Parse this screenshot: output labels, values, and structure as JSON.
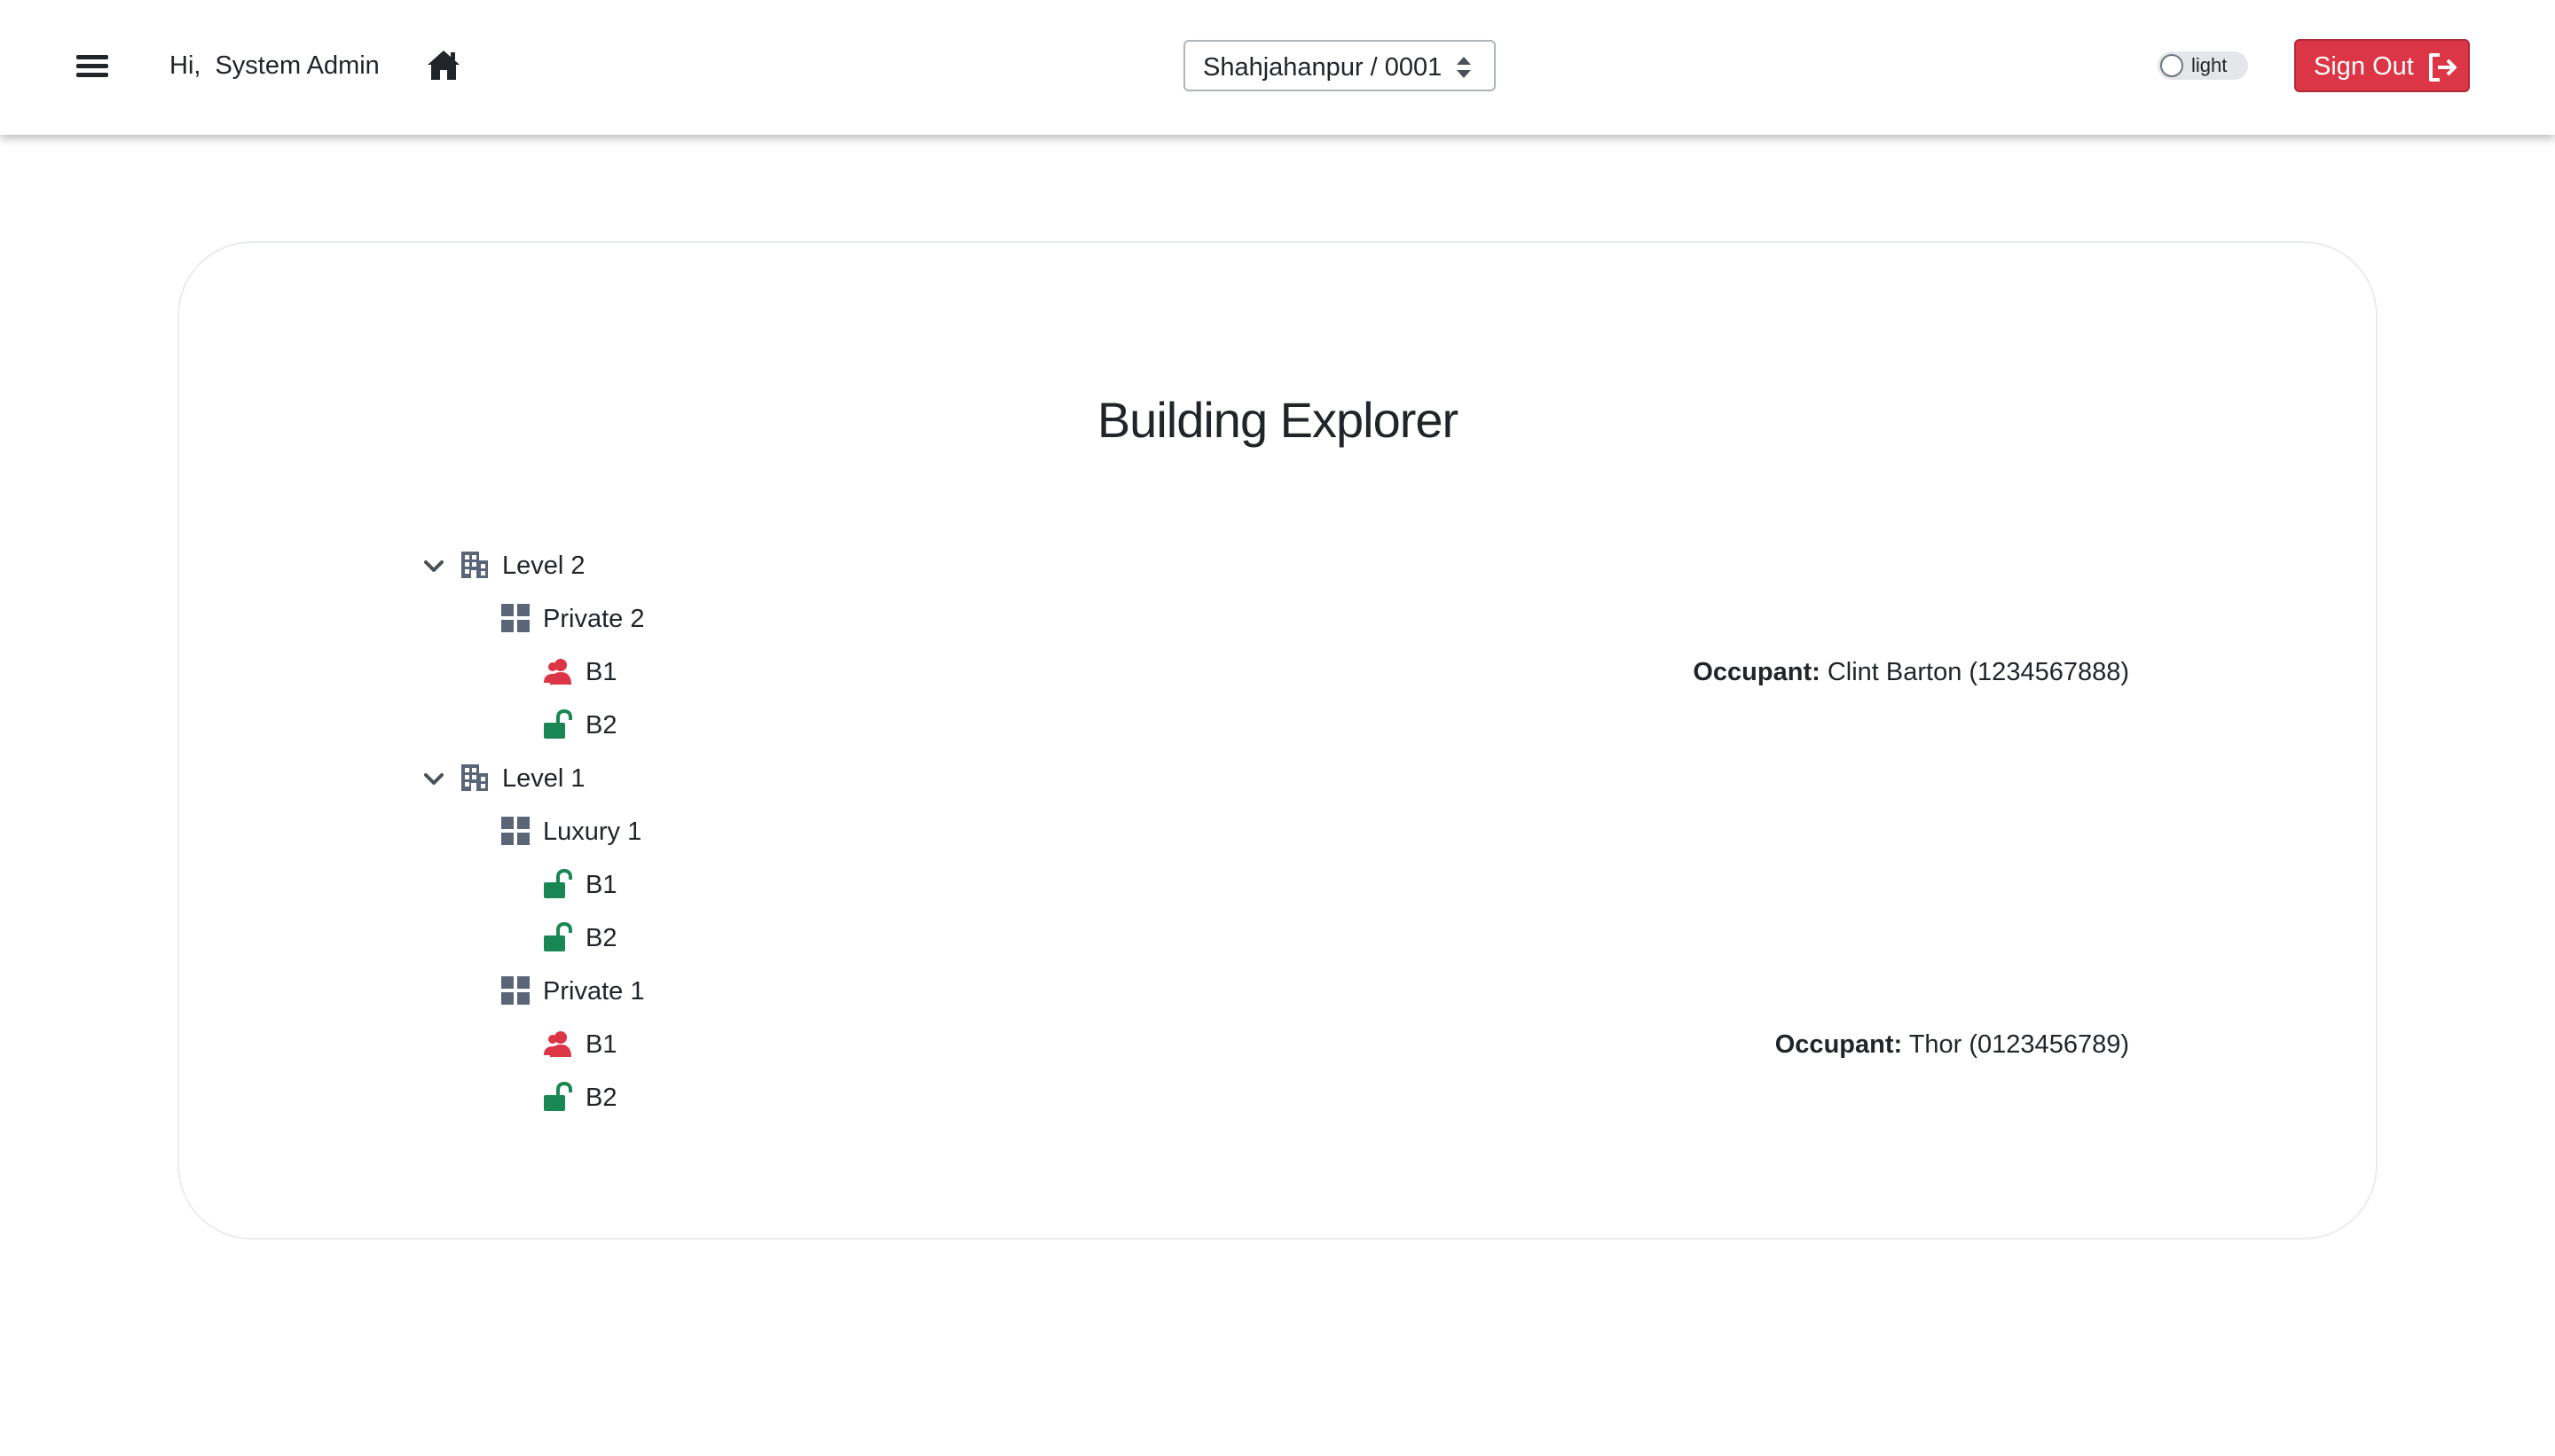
{
  "header": {
    "greeting": "Hi,",
    "user_name": "System Admin",
    "site_selector": {
      "value": "Shahjahanpur / 0001"
    },
    "theme_toggle": {
      "label": "light",
      "checked": false
    },
    "sign_out_label": "Sign Out"
  },
  "page": {
    "title": "Building Explorer"
  },
  "tree": {
    "level2": {
      "label": "Level 2",
      "private2": {
        "label": "Private 2",
        "b1": {
          "label": "B1",
          "status": "occupied",
          "occupant_prefix": "Occupant:",
          "occupant": "Clint Barton (1234567888)"
        },
        "b2": {
          "label": "B2",
          "status": "available"
        }
      }
    },
    "level1": {
      "label": "Level 1",
      "luxury1": {
        "label": "Luxury 1",
        "b1": {
          "label": "B1",
          "status": "available"
        },
        "b2": {
          "label": "B2",
          "status": "available"
        }
      },
      "private1": {
        "label": "Private 1",
        "b1": {
          "label": "B1",
          "status": "occupied",
          "occupant_prefix": "Occupant:",
          "occupant": "Thor (0123456789)"
        },
        "b2": {
          "label": "B2",
          "status": "available"
        }
      }
    }
  },
  "colors": {
    "accent_danger": "#dc3545",
    "available_green": "#198754",
    "occupied_red": "#dc3545",
    "icon_slate": "#5a6678"
  }
}
